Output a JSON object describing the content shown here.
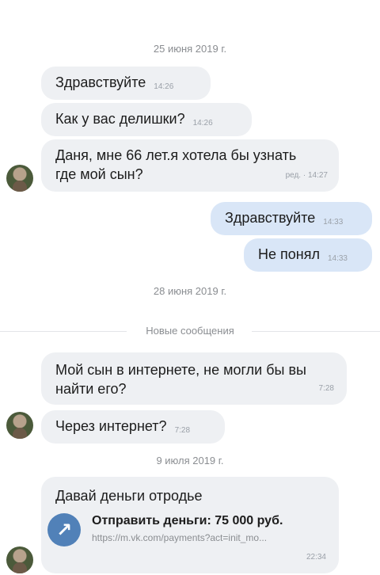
{
  "dates": {
    "d1": "25 июня 2019 г.",
    "d2": "28 июня 2019 г.",
    "d3": "9 июля 2019 г."
  },
  "new_messages_label": "Новые сообщения",
  "messages": [
    {
      "text": "Здравствуйте",
      "time": "14:26"
    },
    {
      "text": "Как у вас делишки?",
      "time": "14:26"
    },
    {
      "text": "Даня, мне 66 лет.я хотела бы узнать где мой сын?",
      "time": "ред. · 14:27"
    },
    {
      "text": "Здравствуйте",
      "time": "14:33"
    },
    {
      "text": "Не понял",
      "time": "14:33"
    },
    {
      "text": "Мой сын в интернете, не могли бы вы найти его?",
      "time": "7:28"
    },
    {
      "text": "Через интернет?",
      "time": "7:28"
    },
    {
      "text": "Давай деньги отродье",
      "time": "22:34"
    }
  ],
  "link": {
    "icon": "arrow-up-right-icon",
    "icon_glyph": "↗",
    "title": "Отправить деньги: 75 000 руб.",
    "url": "https://m.vk.com/payments?act=init_mo..."
  }
}
